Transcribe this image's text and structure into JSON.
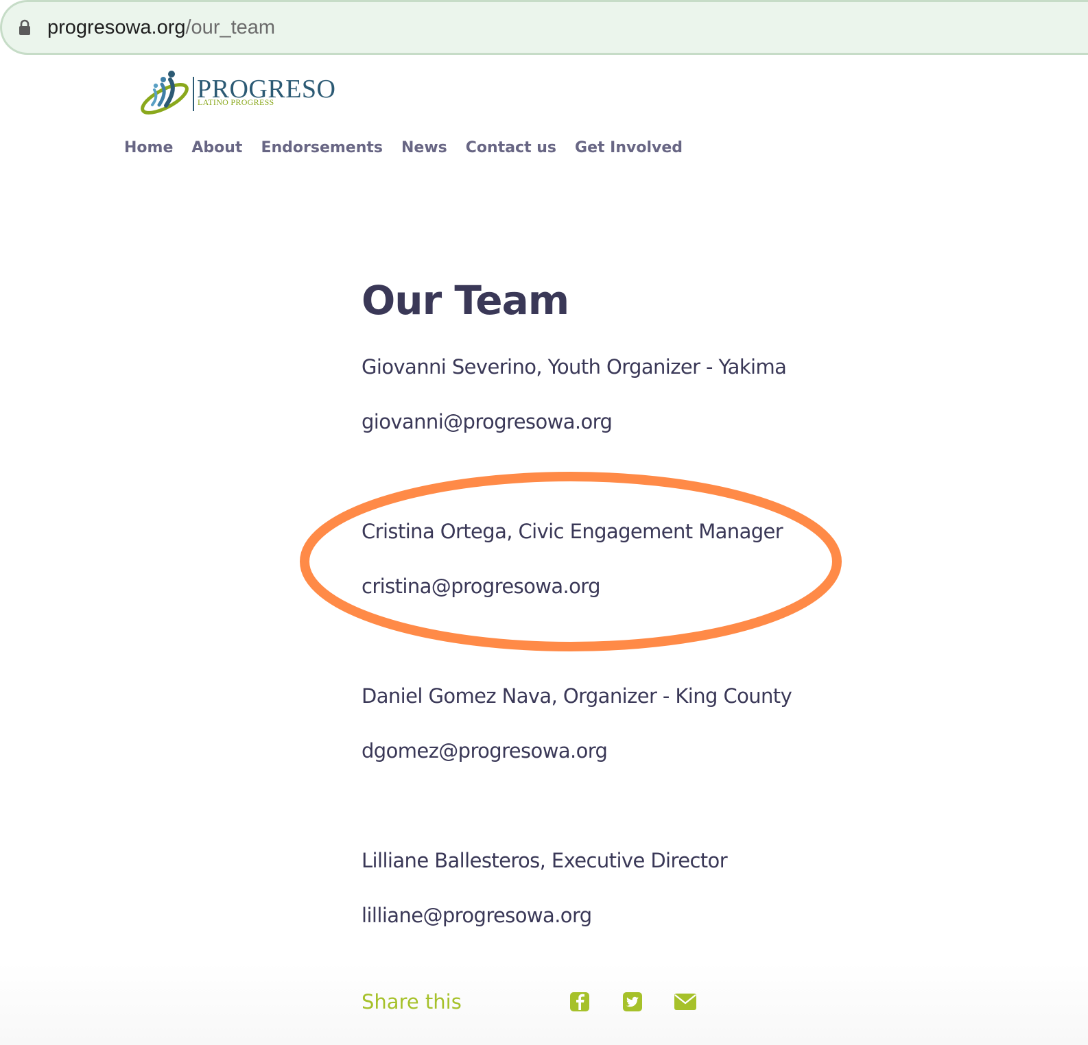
{
  "browser": {
    "url_domain": "progresowa.org",
    "url_path": "/our_team",
    "lock_icon": "lock-icon"
  },
  "logo": {
    "name": "PROGRESO",
    "tagline": "LATINO PROGRESS",
    "colors": {
      "blue": "#2c5a74",
      "green": "#8aa81c"
    }
  },
  "nav": {
    "items": [
      {
        "label": "Home"
      },
      {
        "label": "About"
      },
      {
        "label": "Endorsements"
      },
      {
        "label": "News"
      },
      {
        "label": "Contact us"
      },
      {
        "label": "Get Involved"
      }
    ]
  },
  "main": {
    "title": "Our Team",
    "team": [
      {
        "name_role": "Giovanni Severino, Youth Organizer - Yakima",
        "email": "giovanni@progresowa.org"
      },
      {
        "name_role": "Cristina Ortega, Civic Engagement Manager",
        "email": "cristina@progresowa.org",
        "highlighted": true
      },
      {
        "name_role": "Daniel Gomez Nava, Organizer - King County",
        "email": "dgomez@progresowa.org"
      },
      {
        "name_role": "Lilliane Ballesteros, Executive Director",
        "email": "lilliane@progresowa.org"
      }
    ]
  },
  "share": {
    "label": "Share this",
    "icons": [
      "facebook-icon",
      "twitter-icon",
      "email-icon"
    ]
  },
  "colors": {
    "text": "#3a3857",
    "nav": "#686684",
    "accent_green": "#a6c12a",
    "highlight_orange": "#ff8a47",
    "address_bar_bg": "#ebf5ec"
  }
}
